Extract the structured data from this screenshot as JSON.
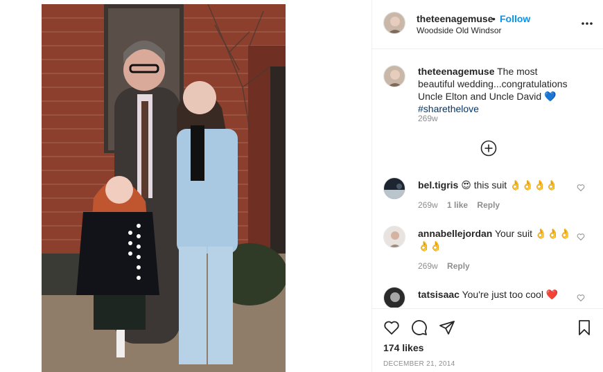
{
  "post": {
    "image_alt": "Two girls and a man in a suit posing in front of a brick house"
  },
  "header": {
    "username": "theteenagemuse",
    "dot": "•",
    "follow_label": "Follow",
    "location": "Woodside Old Windsor",
    "more_icon": "more-horizontal-icon"
  },
  "caption": {
    "username": "theteenagemuse",
    "text": "The most beautiful wedding...congratulations Uncle Elton and Uncle David 💙",
    "hashtag": "#sharethelove",
    "age": "269w"
  },
  "load_more_icon": "plus-circle-icon",
  "comments": [
    {
      "username": "bel.tigris",
      "text": "😍 this suit 👌👌👌👌",
      "age": "269w",
      "likes": "1 like",
      "reply": "Reply"
    },
    {
      "username": "annabellejordan",
      "text": "Your suit 👌👌👌 👌👌",
      "age": "269w",
      "reply": "Reply"
    },
    {
      "username": "tatsisaac",
      "text": "You're just too cool ❤️"
    }
  ],
  "actions": {
    "like_icon": "heart-icon",
    "comment_icon": "comment-icon",
    "share_icon": "paper-plane-icon",
    "save_icon": "bookmark-icon"
  },
  "likes_label": "174 likes",
  "date_label": "DECEMBER 21, 2014",
  "colors": {
    "link": "#0095f6",
    "hashtag": "#00376b",
    "muted": "#8e8e8e",
    "border": "#efefef"
  }
}
